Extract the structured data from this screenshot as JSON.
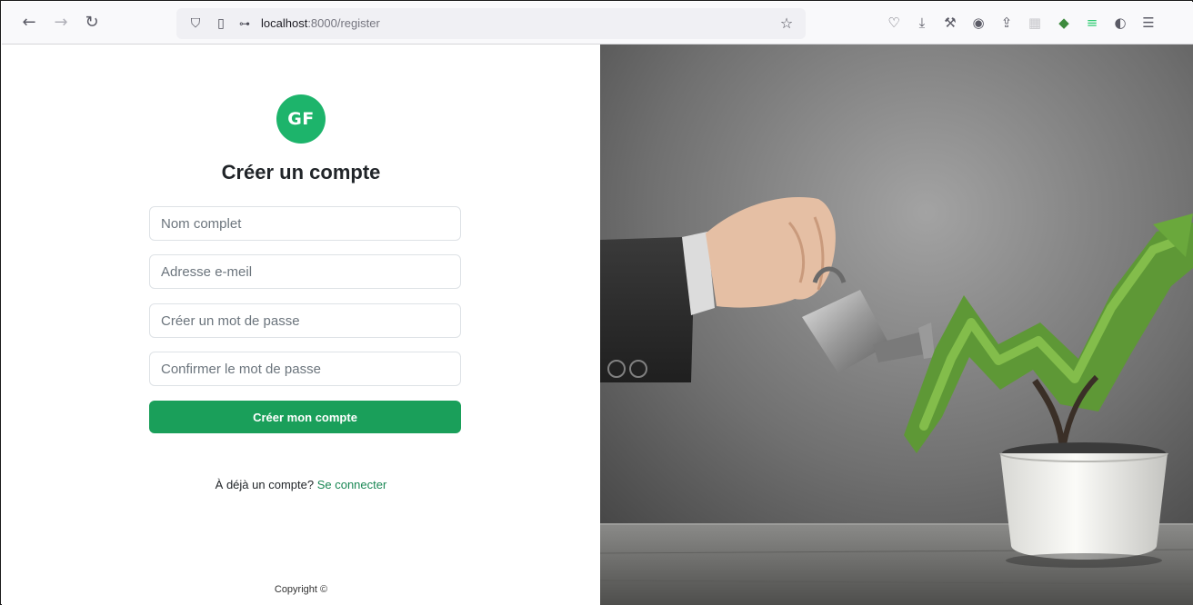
{
  "browser": {
    "url_host": "localhost",
    "url_path": ":8000/register",
    "icons": {
      "back": "arrow-left-icon",
      "forward": "arrow-right-icon",
      "reload": "reload-icon",
      "tracking": "shield-icon",
      "page": "page-icon",
      "permissions": "permissions-icon",
      "bookmark": "star-icon",
      "toolbar": [
        "pocket-icon",
        "download-icon",
        "wrench-icon",
        "account-icon",
        "share-icon",
        "extension-icon",
        "gem-icon",
        "lines-icon",
        "privacy-icon",
        "menu-icon"
      ]
    }
  },
  "register": {
    "logo_text": "GF",
    "title": "Créer un compte",
    "fields": {
      "fullname_placeholder": "Nom complet",
      "email_placeholder": "Adresse e-meil",
      "password_placeholder": "Créer un mot de passe",
      "confirm_placeholder": "Confirmer le mot de passe"
    },
    "submit_label": "Créer mon compte",
    "login_prompt": "À déjà un compte?",
    "login_link": "Se connecter",
    "copyright": "Copyright ©"
  },
  "colors": {
    "brand_green": "#1db46b",
    "button_green": "#1a9f5a",
    "link_green": "#198754"
  }
}
